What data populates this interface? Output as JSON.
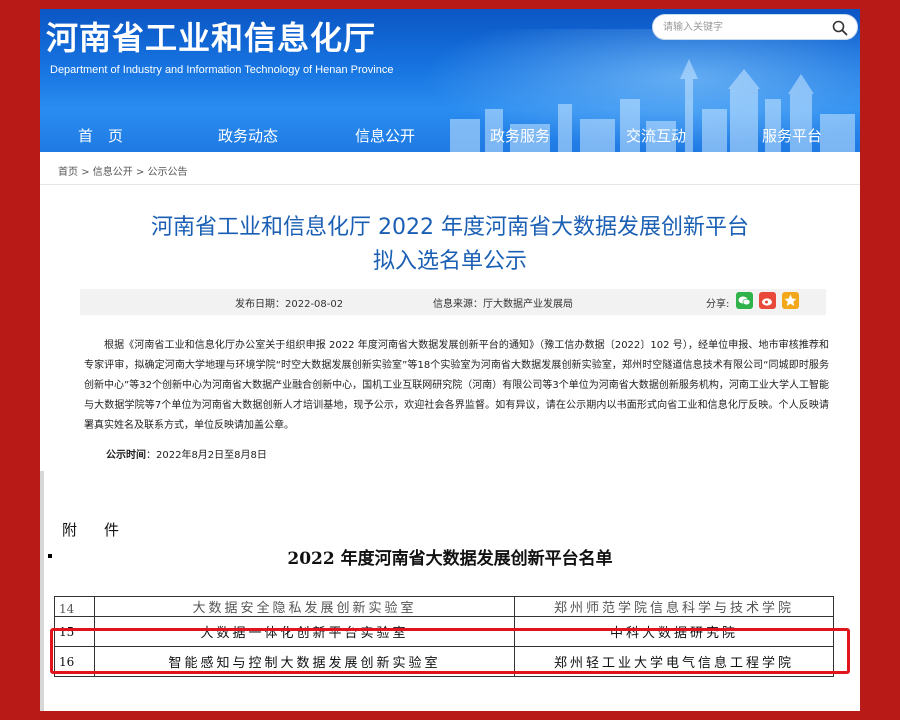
{
  "site": {
    "title": "河南省工业和信息化厅",
    "subtitle": "Department of Industry and Information Technology of Henan Province",
    "search_placeholder": "请输入关键字"
  },
  "nav": [
    "首　页",
    "政务动态",
    "信息公开",
    "政务服务",
    "交流互动",
    "服务平台"
  ],
  "breadcrumb": [
    "首页",
    "信息公开",
    "公示公告"
  ],
  "article": {
    "title_line1": "河南省工业和信息化厅 2022 年度河南省大数据发展创新平台",
    "title_line2": "拟入选名单公示",
    "publish_date": "发布日期：2022-08-02",
    "source": "信息来源：厅大数据产业发展局",
    "share_label": "分享:",
    "body": "根据《河南省工业和信息化厅办公室关于组织申报 2022 年度河南省大数据发展创新平台的通知》（豫工信办数据〔2022〕102 号），经单位申报、地市审核推荐和专家评审，拟确定河南大学地理与环境学院“时空大数据发展创新实验室”等18个实验室为河南省大数据发展创新实验室，郑州时空隧道信息技术有限公司“同城即时服务创新中心”等32个创新中心为河南省大数据产业融合创新中心，国机工业互联网研究院（河南）有限公司等3个单位为河南省大数据创新服务机构，河南工业大学人工智能与大数据学院等7个单位为河南省大数据创新人才培训基地，现予公示，欢迎社会各界监督。如有异议，请在公示期内以书面形式向省工业和信息化厅反映。个人反映请署真实姓名及联系方式，单位反映请加盖公章。",
    "notice_label": "公示时间",
    "notice_value": "：2022年8月2日至8月8日"
  },
  "attachment": {
    "label": "附　件",
    "list_title": "2022 年度河南省大数据发展创新平台名单",
    "rows": [
      {
        "num": "14",
        "lab": "大数据安全隐私发展创新实验室",
        "org": "郑州师范学院信息科学与技术学院"
      },
      {
        "num": "15",
        "lab": "大数据一体化创新平台实验室",
        "org": "中科大数据研究院"
      },
      {
        "num": "16",
        "lab": "智能感知与控制大数据发展创新实验室",
        "org": "郑州轻工业大学电气信息工程学院"
      }
    ]
  },
  "colors": {
    "frame": "#b81a17",
    "banner": "#1673e0",
    "title": "#1a5fb4",
    "highlight": "#e0141c"
  }
}
